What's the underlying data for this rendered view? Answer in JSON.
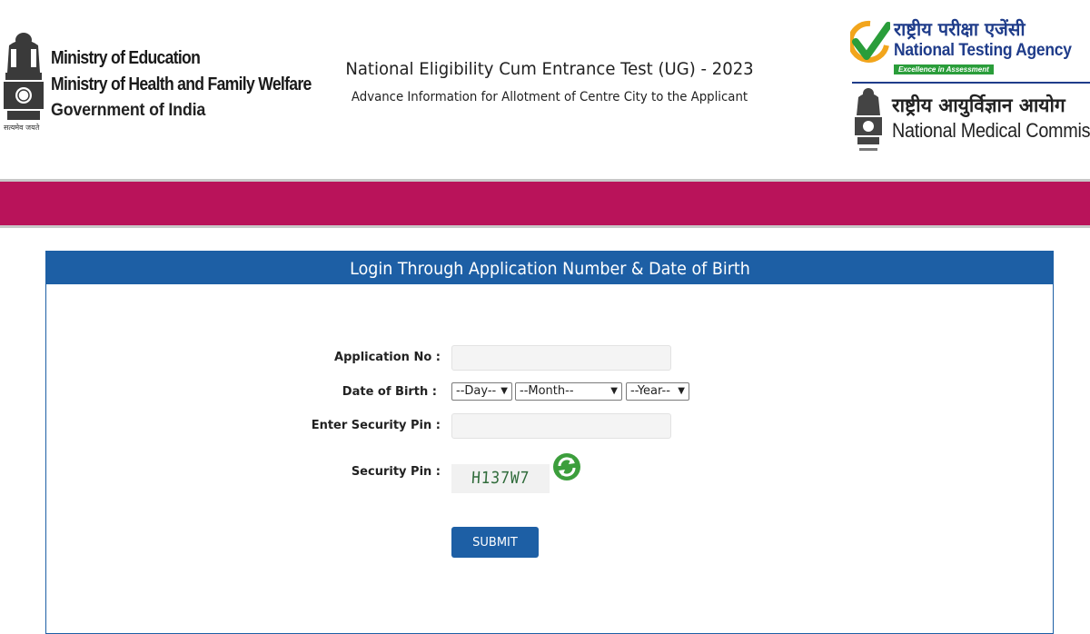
{
  "header": {
    "gov_lines": [
      "Ministry of Education",
      "Ministry of Health and Family Welfare",
      "Government of India"
    ],
    "emblem_motto": "सत्यमेव जयते",
    "title": "National Eligibility Cum Entrance Test (UG) - 2023",
    "subtitle": "Advance Information for Allotment of Centre City to the Applicant",
    "nta": {
      "hindi": "राष्ट्रीय परीक्षा एजेंसी",
      "english": "National Testing Agency",
      "tagline": "Excellence in Assessment"
    },
    "nmc": {
      "hindi": "राष्ट्रीय आयुर्विज्ञान आयोग",
      "english": "National Medical Commission"
    }
  },
  "colors": {
    "band": "#b9135a",
    "panel_header": "#1d5fa5",
    "submit": "#1d5fa5",
    "nta_blue": "#1f3c8a",
    "nta_green": "#2a9d3a"
  },
  "login": {
    "heading": "Login Through Application Number & Date of Birth",
    "application_no_label": "Application No :",
    "application_no_value": "",
    "dob_label": "Date of Birth :",
    "day_selected": "--Day--",
    "month_selected": "--Month--",
    "year_selected": "--Year--",
    "security_pin_input_label": "Enter Security Pin :",
    "security_pin_value": "",
    "security_pin_label": "Security Pin :",
    "captcha_text": "H137W7",
    "submit_label": "SUBMIT"
  },
  "icons": {
    "refresh": "refresh-icon",
    "dropdown": "chevron-down-icon",
    "emblem": "national-emblem-icon",
    "nta_logo": "nta-checkmark-logo-icon"
  }
}
